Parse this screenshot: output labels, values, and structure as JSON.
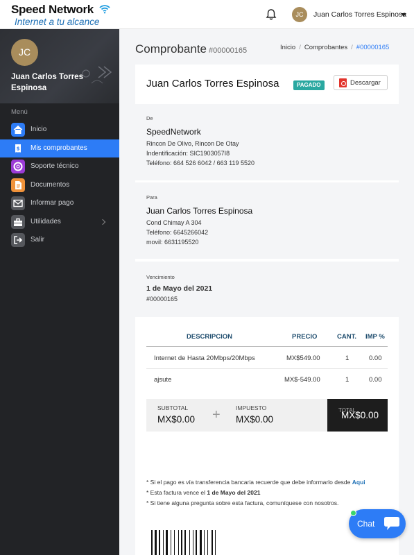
{
  "brand": {
    "name": "Speed Network",
    "tagline": "Internet a tu alcance"
  },
  "topbar": {
    "avatar_initials": "JC",
    "user_name": "Juan Carlos Torres Espinosa"
  },
  "sidebar": {
    "avatar_initials": "JC",
    "user_name": "Juan Carlos Torres Espinosa",
    "menu_heading": "Menú",
    "items": [
      {
        "label": "Inicio",
        "icon": "home-icon",
        "color": "#2d7cf6"
      },
      {
        "label": "Mis comprobantes",
        "icon": "receipt-icon",
        "color": "#2d7cf6"
      },
      {
        "label": "Soporte técnico",
        "icon": "lifebuoy-icon",
        "color": "#9b3bd6"
      },
      {
        "label": "Documentos",
        "icon": "document-icon",
        "color": "#f0923a"
      },
      {
        "label": "Informar pago",
        "icon": "envelope-icon",
        "color": "#555"
      },
      {
        "label": "Utilidades",
        "icon": "toolbox-icon",
        "color": "#555"
      },
      {
        "label": "Salir",
        "icon": "logout-icon",
        "color": "#555"
      }
    ]
  },
  "page": {
    "title": "Comprobante",
    "number": "#00000165"
  },
  "breadcrumb": {
    "home": "Inicio",
    "section": "Comprobantes",
    "current": "#00000165"
  },
  "invoice": {
    "customer": "Juan Carlos Torres Espinosa",
    "status": "PAGADO",
    "download_label": "Descargar",
    "from": {
      "label": "De",
      "name": "SpeedNetwork",
      "address": "Rincon De Olivo, Rincon De Otay",
      "id": "Indentificación: SIC1903057I8",
      "phone": "Teléfono: 664 526 6042 / 663 119 5520"
    },
    "to": {
      "label": "Para",
      "name": "Juan Carlos Torres Espinosa",
      "address": "Cond Chimay A 304",
      "phone": "Teléfono: 6645266042",
      "mobile": "movil: 6631195520"
    },
    "due": {
      "label": "Vencimiento",
      "date": "1 de Mayo del 2021",
      "number": "#00000165"
    }
  },
  "table": {
    "headers": {
      "description": "DESCRIPCION",
      "price": "PRECIO",
      "qty": "CANT.",
      "tax": "IMP %"
    },
    "rows": [
      {
        "description": "Internet de Hasta 20Mbps/20Mbps",
        "price": "MX$549.00",
        "qty": "1",
        "tax": "0.00"
      },
      {
        "description": "ajsute",
        "price": "MX$-549.00",
        "qty": "1",
        "tax": "0.00"
      }
    ]
  },
  "totals": {
    "subtotal_label": "SUBTOTAL",
    "subtotal": "MX$0.00",
    "tax_label": "IMPUESTO",
    "tax": "MX$0.00",
    "total_label": "TOTAL",
    "total": "MX$0.00"
  },
  "notes": {
    "line1": "* Si el pago es vía transferencia bancaria recuerde que debe informarlo desde ",
    "line1_link": "Aqui",
    "line2_prefix": "* Esta factura vence el ",
    "line2_date": "1 de Mayo del 2021",
    "line3": "* Si tiene alguna pregunta sobre esta factura, comuníquese con nosotros."
  },
  "chat": {
    "label": "Chat"
  },
  "colors": {
    "accent": "#2d7cf6",
    "badge": "#2aa8a1",
    "sidebar": "#222326"
  }
}
